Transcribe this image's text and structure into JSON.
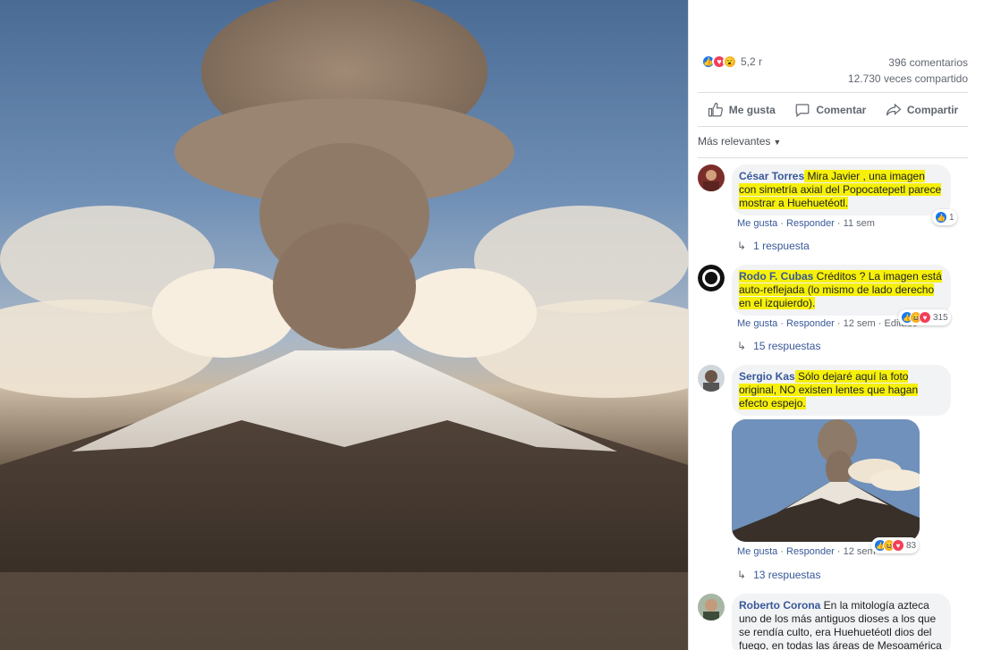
{
  "post": {
    "reactions_count": "5,2 r",
    "comments_count": "396 comentarios",
    "shares_count": "12.730 veces compartido"
  },
  "actions": {
    "like": "Me gusta",
    "comment": "Comentar",
    "share": "Compartir"
  },
  "sort_label": "Más relevantes",
  "comments": [
    {
      "author": "César Torres",
      "text": " Mira Javier , una imagen con simetría axial del Popocatepetl parece mostrar a Huehuetéotl.",
      "like": "Me gusta",
      "reply": "Responder",
      "time": "11 sem",
      "reaction_count": "1",
      "replies": "1 respuesta"
    },
    {
      "author": "Rodo F. Cubas",
      "text": " Créditos ? La imagen está auto-reflejada (lo mismo de lado derecho en el izquierdo).",
      "like": "Me gusta",
      "reply": "Responder",
      "time": "12 sem",
      "edited": "Editado",
      "reaction_count": "315",
      "replies": "15 respuestas"
    },
    {
      "author": "Sergio Kas",
      "text": " Sólo dejaré aquí la foto original, NO existen lentes que hagan efecto espejo.",
      "like": "Me gusta",
      "reply": "Responder",
      "time": "12 sem",
      "reaction_count": "83",
      "replies": "13 respuestas"
    },
    {
      "author": "Roberto Corona",
      "text": " En la mitología azteca uno de los más antiguos dioses a los que se rendía culto, era Huehuetéotl dios del fuego, en todas las áreas de Mesoamérica"
    }
  ],
  "colors": {
    "link": "#385898",
    "highlight": "#f6f00a",
    "like_blue": "#1877f2"
  }
}
